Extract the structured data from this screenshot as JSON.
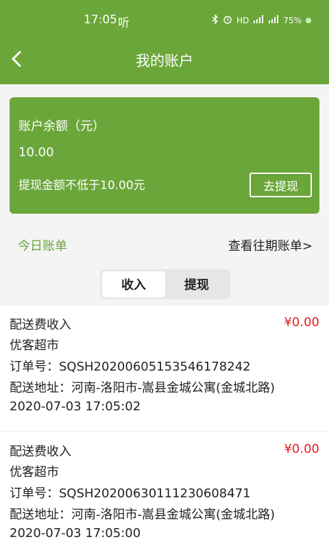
{
  "status_bar": {
    "time": "17:05",
    "listen_glyph": "听",
    "bluetooth_icon": "bluetooth-icon",
    "alarm_icon": "alarm-icon",
    "hd_label": "HD",
    "signal1": "4G",
    "signal2": "4G",
    "battery": "75%"
  },
  "nav": {
    "back_icon": "back-icon",
    "title": "我的账户"
  },
  "account": {
    "balance_label": "账户余额（元）",
    "balance_value": "10.00",
    "min_withdraw_note": "提现金额不低于10.00元",
    "withdraw_button": "去提现"
  },
  "bills": {
    "today_label": "今日账单",
    "history_link": "查看往期账单>"
  },
  "tabs": [
    {
      "label": "收入",
      "active": true
    },
    {
      "label": "提现",
      "active": false
    }
  ],
  "records": [
    {
      "title": "配送费收入",
      "amount": "¥0.00",
      "store": "优客超市",
      "order": "订单号：SQSH2020060515354617824​2",
      "address": "配送地址：河南-洛阳市-嵩县金城公寓(金城北路)",
      "time": "2020-07-03 17:05:02"
    },
    {
      "title": "配送费收入",
      "amount": "¥0.00",
      "store": "优客超市",
      "order": "订单号：SQSH2020063011123060847​1",
      "address": "配送地址：河南-洛阳市-嵩县金城公寓(金城北路)",
      "time": "2020-07-03 17:05:00"
    }
  ],
  "colors": {
    "brand_green": "#6ba63a",
    "amount_red": "#e02020"
  }
}
